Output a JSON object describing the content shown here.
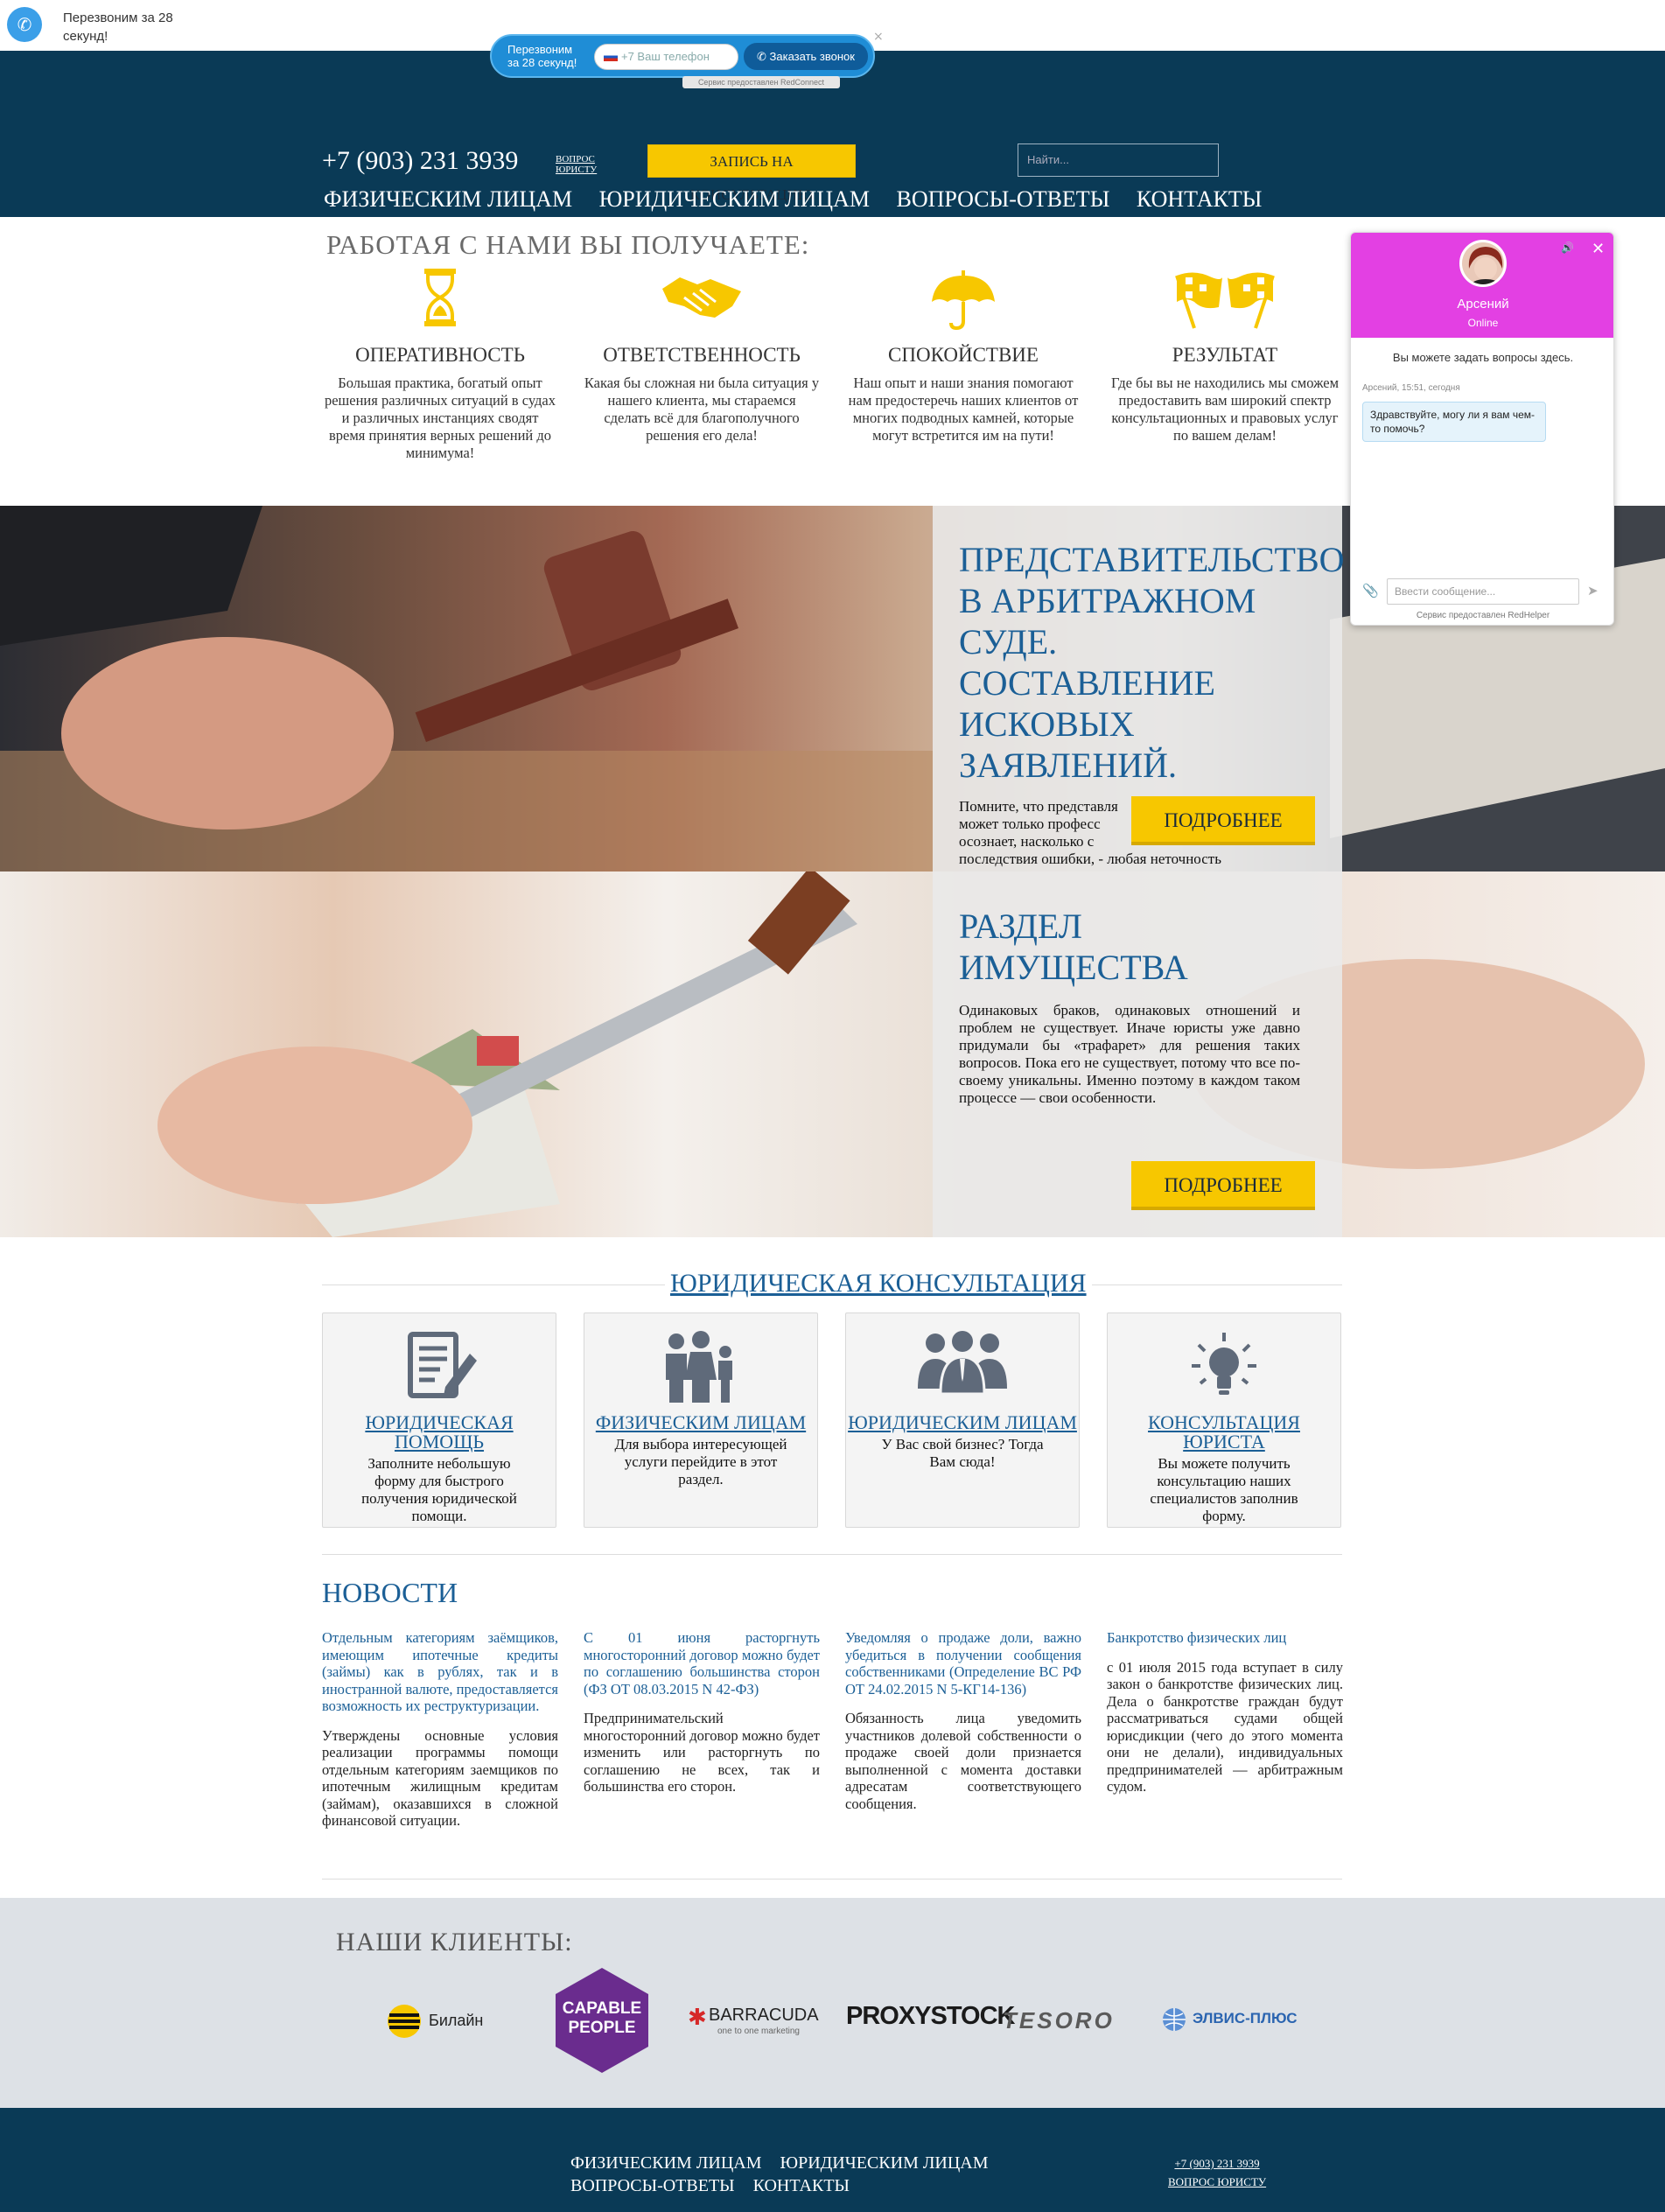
{
  "callback": {
    "label": "Перезвоним за 28 секунд!"
  },
  "redconnect": {
    "label": "Перезвоним за 28 секунд!",
    "phone_placeholder": "+7 Ваш телефон",
    "button": "Заказать звонок",
    "close": "×",
    "service": "Сервис предоставлен RedConnect"
  },
  "header": {
    "phone": "+7 (903) 231 3939",
    "question_link": "ВОПРОС ЮРИСТУ",
    "consult_button": "ЗАПИСЬ НА КОНСУЛЬТАЦИЮ",
    "search_placeholder": "Найти...",
    "nav": [
      "ФИЗИЧЕСКИМ ЛИЦАМ",
      "ЮРИДИЧЕСКИМ ЛИЦАМ",
      "ВОПРОСЫ-ОТВЕТЫ",
      "КОНТАКТЫ"
    ]
  },
  "benefits": {
    "title": "РАБОТАЯ С НАМИ ВЫ ПОЛУЧАЕТЕ:",
    "items": [
      {
        "title": "ОПЕРАТИВНОСТЬ",
        "text": "Большая практика, богатый опыт решения различных ситуаций в судах и различных инстанциях сводят время принятия верных решений до минимума!",
        "icon": "hourglass-icon"
      },
      {
        "title": "ОТВЕТСТВЕННОСТЬ",
        "text": "Какая бы сложная ни была ситуация у нашего клиента, мы стараемся сделать всё для благополучного решения его дела!",
        "icon": "handshake-icon"
      },
      {
        "title": "СПОКОЙСТВИЕ",
        "text": "Наш опыт и наши знания помогают нам предостеречь наших клиентов от многих подводных камней, которые могут встретится им на пути!",
        "icon": "umbrella-icon"
      },
      {
        "title": "РЕЗУЛЬТАТ",
        "text": "Где бы вы не находились мы сможем предоставить вам широкий спектр консультационных и правовых услуг по вашем делам!",
        "icon": "checkered-flags-icon"
      }
    ],
    "accent": "#f7c700"
  },
  "hero1": {
    "title_lines": [
      "ПРЕДСТАВИТЕЛЬСТВО",
      "В АРБИТРАЖНОМ",
      "СУДЕ.",
      "СОСТАВЛЕНИЕ",
      "ИСКОВЫХ",
      "ЗАЯВЛЕНИЙ."
    ],
    "text": "Помните, что представля... может только профессио... осознает, насколько с... последствия ошибки, - любая неточность",
    "text_lines": [
      "Помните, что представля",
      "может только професс",
      "осознает, насколько с",
      "последствия ошибки, - любая неточность"
    ],
    "button": "ПОДРОБНЕЕ"
  },
  "hero2": {
    "title_lines": [
      "РАЗДЕЛ",
      "ИМУЩЕСТВА"
    ],
    "text": "Одинаковых браков, одинаковых отношений и проблем не существует. Иначе юристы уже давно придумали бы «трафарет» для решения таких вопросов. Пока его не существует, потому что все по-своему уникальны. Именно поэтому в каждом таком процессе — свои особенности.",
    "button": "ПОДРОБНЕЕ"
  },
  "consultation": {
    "title": "ЮРИДИЧЕСКАЯ КОНСУЛЬТАЦИЯ",
    "cards": [
      {
        "title": "ЮРИДИЧЕСКАЯ ПОМОЩЬ",
        "text": "Заполните небольшую форму для быстрого получения юридической помощи.",
        "icon": "document-pen-icon"
      },
      {
        "title": "ФИЗИЧЕСКИМ ЛИЦАМ",
        "text": "Для выбора интересующей услуги перейдите в этот раздел.",
        "icon": "family-icon"
      },
      {
        "title": "ЮРИДИЧЕСКИМ ЛИЦАМ",
        "text": "У Вас свой бизнес? Тогда Вам сюда!",
        "icon": "business-people-icon"
      },
      {
        "title": "КОНСУЛЬТАЦИЯ ЮРИСТА",
        "text": "Вы можете получить консультацию наших специалистов заполнив форму.",
        "icon": "lightbulb-icon"
      }
    ]
  },
  "news": {
    "title": "НОВОСТИ",
    "items": [
      {
        "headline": "Отдельным категориям заёмщиков, имеющим ипотечные кредиты (займы) как в рублях, так и в иностранной валюте, предоставляется возможность их реструктуризации.",
        "body": "Утверждены основные условия реализации программы помощи отдельным категориям заемщиков по ипотечным жилищным кредитам (займам), оказавшихся в сложной финансовой ситуации."
      },
      {
        "headline": "С 01 июня расторгнуть многосторонний договор можно будет по соглашению большинства сторон (ФЗ ОТ 08.03.2015 N 42-ФЗ)",
        "body": "Предпринимательский многосторонний договор можно будет изменить или расторгнуть по соглашению не всех, так и большинства его сторон."
      },
      {
        "headline": "Уведомляя о продаже доли, важно убедиться в получении сообщения собственниками (Определение ВС РФ ОТ 24.02.2015 N 5-КГ14-136)",
        "body": "Обязанность лица уведомить участников долевой собственности о продаже своей доли признается выполненной с момента доставки адресатам соответствующего сообщения."
      },
      {
        "headline": "Банкротство физических лиц",
        "body": "с 01 июля 2015 года вступает в силу закон о банкротстве физических лиц. Дела о банкротстве граждан будут рассматриваться судами общей юрисдикции (чего до этого момента они не делали), индивидуальных предпринимателей — арбитражным судом."
      }
    ]
  },
  "clients": {
    "title": "НАШИ КЛИЕНТЫ:",
    "logos": [
      "Билайн",
      "CAPABLE PEOPLE",
      "BARRACUDA",
      "one to one marketing",
      "PROXYSTOCK",
      "TESORO",
      "ЭЛВИС-ПЛЮС"
    ]
  },
  "footer": {
    "nav": [
      "ФИЗИЧЕСКИМ ЛИЦАМ",
      "ЮРИДИЧЕСКИМ ЛИЦАМ",
      "ВОПРОСЫ-ОТВЕТЫ",
      "КОНТАКТЫ"
    ],
    "phone": "+7 (903) 231 3939",
    "question_link": "ВОПРОС ЮРИСТУ"
  },
  "chat": {
    "agent_name": "Арсений",
    "status": "Online",
    "info": "Вы можете задать вопросы здесь.",
    "meta": "Арсений, 15:51, сегодня",
    "message": "Здравствуйте, могу ли я вам чем-то помочь?",
    "input_placeholder": "Ввести сообщение...",
    "service": "Сервис предоставлен RedHelper",
    "close": "✕",
    "color": "#e340e3"
  },
  "colors": {
    "navy": "#0a3a56",
    "blue": "#1b5f96",
    "yellow": "#f7c700"
  }
}
